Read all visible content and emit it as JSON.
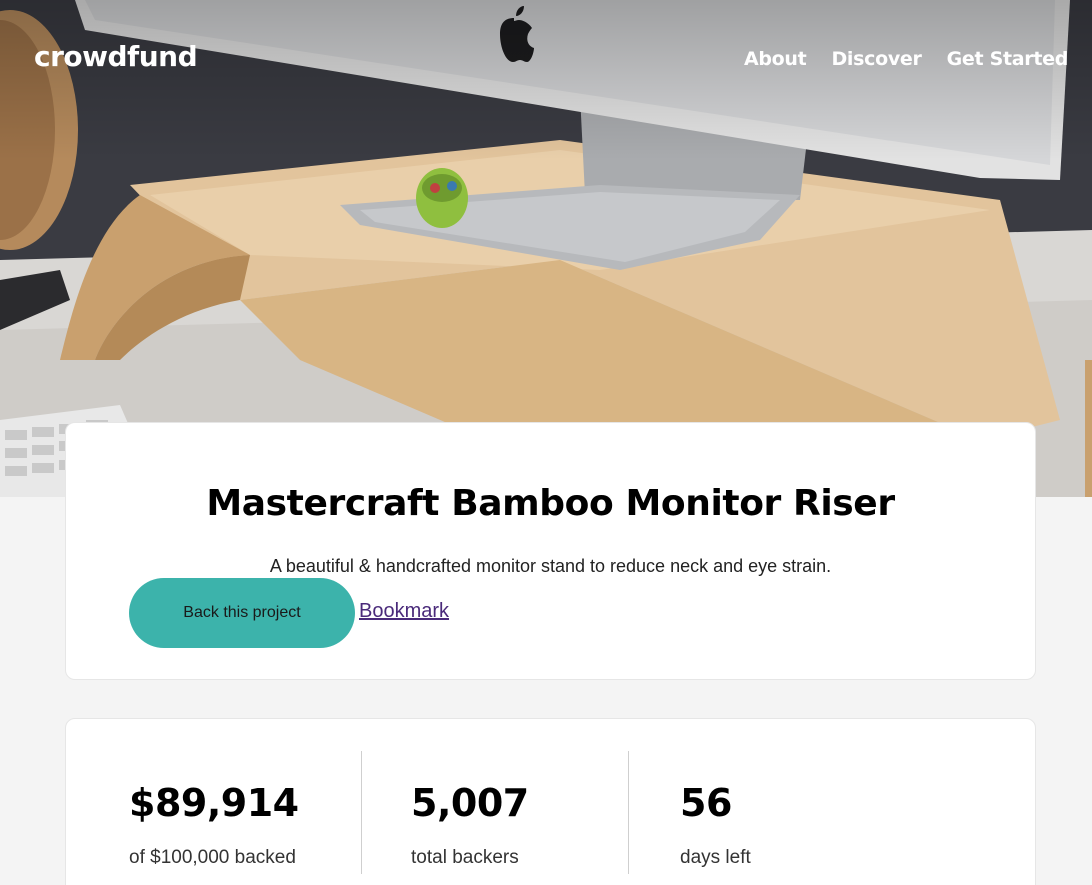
{
  "header": {
    "logo": "crowdfund",
    "nav": [
      "About",
      "Discover",
      "Get Started"
    ]
  },
  "project": {
    "title": "Mastercraft Bamboo Monitor Riser",
    "description": "A beautiful & handcrafted monitor stand to reduce neck and eye strain.",
    "back_label": "Back this project",
    "bookmark_label": "Bookmark"
  },
  "stats": [
    {
      "value": "$89,914",
      "label": "of $100,000 backed"
    },
    {
      "value": "5,007",
      "label": "total backers"
    },
    {
      "value": "56",
      "label": "days left"
    }
  ],
  "colors": {
    "accent": "#3cb3ab",
    "link": "#4a2a7a"
  },
  "icons": {
    "brand_logo": "apple-logo-icon"
  }
}
